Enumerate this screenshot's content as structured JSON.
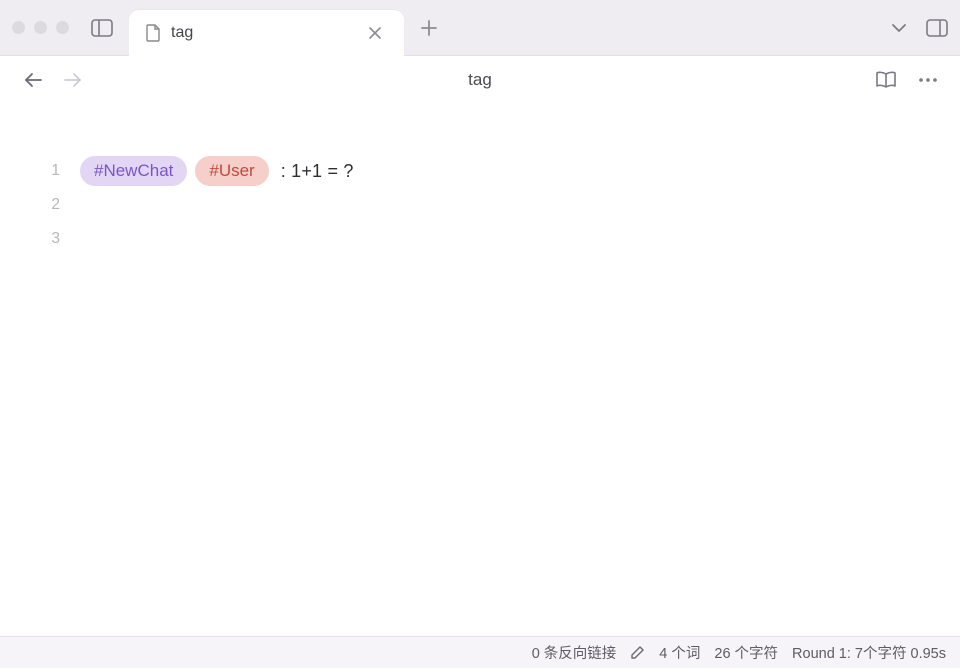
{
  "tabs": {
    "active": {
      "title": "tag"
    }
  },
  "header": {
    "title": "tag"
  },
  "editor": {
    "line_numbers": [
      "1",
      "2",
      "3"
    ],
    "line1": {
      "tag1": "#NewChat",
      "tag2": "#User",
      "rest": ": 1+1 = ?"
    }
  },
  "statusbar": {
    "backlinks": "0 条反向链接",
    "words": "4 个词",
    "chars": "26 个字符",
    "round": "Round 1: 7个字符 0.95s"
  }
}
